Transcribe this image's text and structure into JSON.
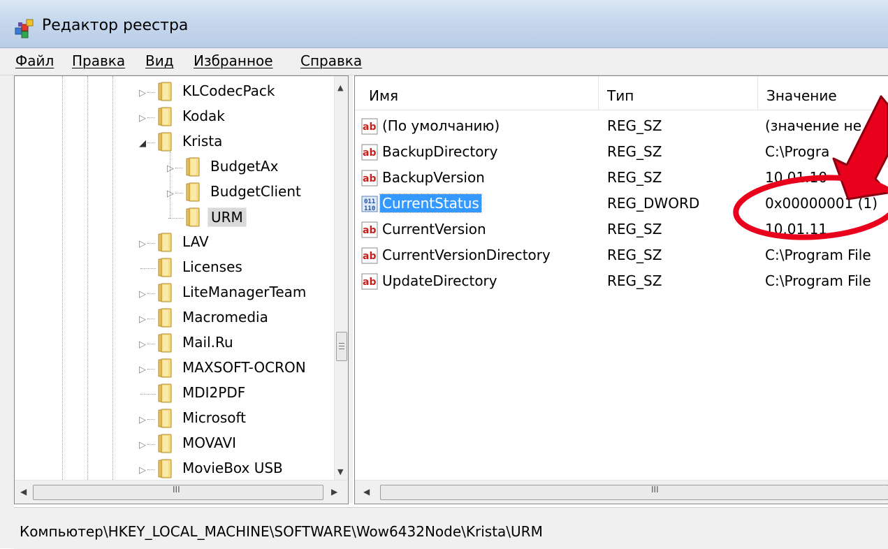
{
  "window": {
    "title": "Редактор реестра"
  },
  "menu": [
    "Файл",
    "Правка",
    "Вид",
    "Избранное",
    "Справка"
  ],
  "tree": [
    {
      "label": "KLCodecPack",
      "expander": "collapsed"
    },
    {
      "label": "Kodak",
      "expander": "collapsed"
    },
    {
      "label": "Krista",
      "expander": "expanded"
    },
    {
      "label": "BudgetAx",
      "expander": "collapsed"
    },
    {
      "label": "BudgetClient",
      "expander": "collapsed"
    },
    {
      "label": "URM",
      "expander": "none",
      "selected": true
    },
    {
      "label": "LAV",
      "expander": "collapsed"
    },
    {
      "label": "Licenses",
      "expander": "none"
    },
    {
      "label": "LiteManagerTeam",
      "expander": "collapsed"
    },
    {
      "label": "Macromedia",
      "expander": "collapsed"
    },
    {
      "label": "Mail.Ru",
      "expander": "collapsed"
    },
    {
      "label": "MAXSOFT-OCRON",
      "expander": "collapsed"
    },
    {
      "label": "MDI2PDF",
      "expander": "none"
    },
    {
      "label": "Microsoft",
      "expander": "collapsed"
    },
    {
      "label": "MOVAVI",
      "expander": "collapsed"
    },
    {
      "label": "MovieBox USB",
      "expander": "collapsed"
    }
  ],
  "columns": {
    "name": "Имя",
    "type": "Тип",
    "value": "Значение"
  },
  "values": [
    {
      "name": "(По умолчанию)",
      "type": "REG_SZ",
      "data": "(значение не",
      "kind": "string"
    },
    {
      "name": "BackupDirectory",
      "type": "REG_SZ",
      "data": "C:\\Progra",
      "kind": "string"
    },
    {
      "name": "BackupVersion",
      "type": "REG_SZ",
      "data": "10.01.10",
      "kind": "string"
    },
    {
      "name": "CurrentStatus",
      "type": "REG_DWORD",
      "data": "0x00000001 (1)",
      "kind": "dword",
      "selected": true
    },
    {
      "name": "CurrentVersion",
      "type": "REG_SZ",
      "data": "10.01.11",
      "kind": "string"
    },
    {
      "name": "CurrentVersionDirectory",
      "type": "REG_SZ",
      "data": "C:\\Program File",
      "kind": "string"
    },
    {
      "name": "UpdateDirectory",
      "type": "REG_SZ",
      "data": "C:\\Program File",
      "kind": "string"
    }
  ],
  "status": {
    "path": "Компьютер\\HKEY_LOCAL_MACHINE\\SOFTWARE\\Wow6432Node\\Krista\\URM"
  },
  "scrollbars": {
    "horizontal_grip": "III"
  },
  "icons": {
    "string": "reg-sz-icon",
    "dword": "reg-dword-icon",
    "folder": "folder-icon",
    "app": "regedit-icon"
  },
  "annotation": {
    "color": "#e8001c"
  }
}
